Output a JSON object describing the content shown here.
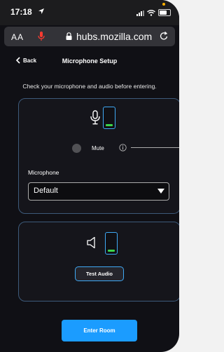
{
  "status_bar": {
    "time": "17:18"
  },
  "browser": {
    "text_size_label": "AA",
    "url": "hubs.mozilla.com"
  },
  "header": {
    "back_label": "Back",
    "title": "Microphone Setup"
  },
  "instruction": "Check your microphone and audio before entering.",
  "microphone": {
    "mute_label": "Mute",
    "field_label": "Microphone",
    "selected_device": "Default"
  },
  "speaker": {
    "test_button_label": "Test Audio"
  },
  "footer": {
    "enter_button_label": "Enter Room"
  },
  "colors": {
    "accent": "#3fa9f5",
    "primary_button": "#1b9cff",
    "level_indicator": "#3cd44a",
    "background": "#101015"
  }
}
